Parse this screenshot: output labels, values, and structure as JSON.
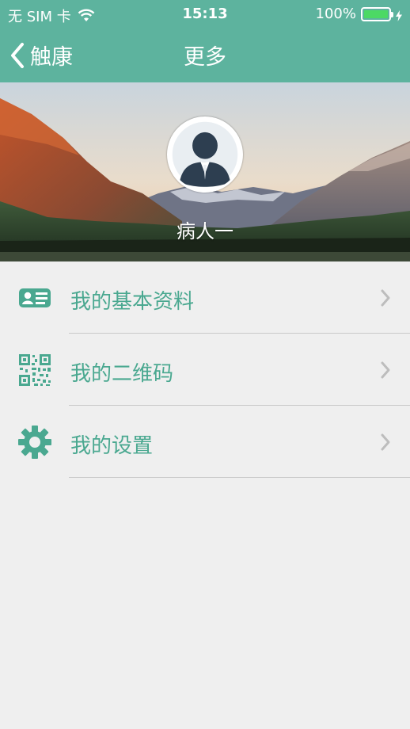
{
  "status_bar": {
    "carrier": "无 SIM 卡",
    "time": "15:13",
    "battery": "100%",
    "battery_level": 1.0
  },
  "nav": {
    "back_label": "触康",
    "title": "更多"
  },
  "profile": {
    "name": "病人一"
  },
  "menu": {
    "items": [
      {
        "label": "我的基本资料",
        "icon": "id-card-icon"
      },
      {
        "label": "我的二维码",
        "icon": "qr-code-icon"
      },
      {
        "label": "我的设置",
        "icon": "gear-icon"
      }
    ]
  },
  "colors": {
    "accent": "#5db39e",
    "menu_text": "#4aa890",
    "background": "#efefef"
  }
}
